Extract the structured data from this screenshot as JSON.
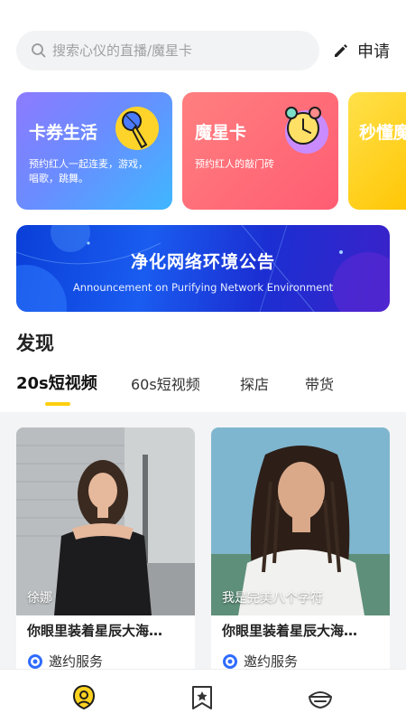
{
  "search": {
    "placeholder": "搜索心仪的直播/魔星卡",
    "apply_label": "申请"
  },
  "cards": [
    {
      "title": "卡券生活",
      "desc": "预约红人一起连麦，游戏，唱歌，跳舞。",
      "icon": "microphone-icon",
      "color": "#7f86ff"
    },
    {
      "title": "魔星卡",
      "desc": "预约红人的敲门砖",
      "icon": "alarm-clock-icon",
      "color": "#ff6a78"
    },
    {
      "title": "秒懂魔",
      "desc": "",
      "icon": "",
      "color": "#ffd21f"
    }
  ],
  "banner": {
    "title": "净化网络环境公告",
    "subtitle": "Announcement on Purifying Network Environment"
  },
  "discover": {
    "title": "发现",
    "tabs": [
      "20s短视频",
      "60s短视频",
      "探店",
      "带货"
    ],
    "active_tab": 0,
    "accent": "#ffcf0f"
  },
  "videos": [
    {
      "name": "徐娜",
      "title": "你眼里装着星辰大海…",
      "service": "邀约服务"
    },
    {
      "name": "我是完美八个字符",
      "title": "你眼里装着星辰大海…",
      "service": "邀约服务"
    }
  ],
  "nav": {
    "items": [
      {
        "icon": "home-badge-icon",
        "active": true
      },
      {
        "icon": "bookmark-star-icon",
        "active": false
      },
      {
        "icon": "bowl-icon",
        "active": false
      }
    ]
  }
}
